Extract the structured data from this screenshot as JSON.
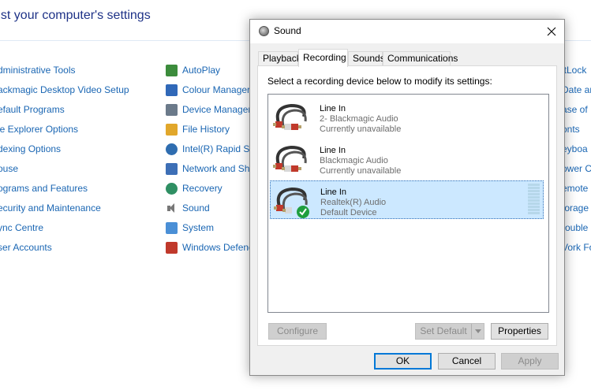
{
  "control_panel": {
    "title": "ust your computer's settings",
    "left_column": [
      "dministrative Tools",
      "ackmagic Desktop Video Setup",
      "efault Programs",
      "le Explorer Options",
      "dexing Options",
      "ouse",
      "ograms and Features",
      "ecurity and Maintenance",
      "ync Centre",
      "ser Accounts"
    ],
    "middle_column": [
      {
        "label": "AutoPlay",
        "icon": "autoplay-icon"
      },
      {
        "label": "Colour Manager",
        "icon": "colour-management-icon"
      },
      {
        "label": "Device Manager",
        "icon": "device-manager-icon"
      },
      {
        "label": "File History",
        "icon": "file-history-icon"
      },
      {
        "label": "Intel(R) Rapid Sto",
        "icon": "intel-rapid-storage-icon"
      },
      {
        "label": "Network and Sha",
        "icon": "network-icon"
      },
      {
        "label": "Recovery",
        "icon": "recovery-icon"
      },
      {
        "label": "Sound",
        "icon": "sound-icon"
      },
      {
        "label": "System",
        "icon": "system-icon"
      },
      {
        "label": "Windows Defend",
        "icon": "windows-defender-icon"
      }
    ],
    "right_column": [
      "itLock",
      "Date an",
      "ase of",
      "onts",
      "eyboa",
      "ower C",
      "emote",
      "torage",
      "rouble",
      "Vork Fo"
    ]
  },
  "dialog": {
    "title": "Sound",
    "tabs": [
      {
        "label": "Playback",
        "active": false
      },
      {
        "label": "Recording",
        "active": true
      },
      {
        "label": "Sounds",
        "active": false
      },
      {
        "label": "Communications",
        "active": false
      }
    ],
    "instruction": "Select a recording device below to modify its settings:",
    "devices": [
      {
        "name": "Line In",
        "driver": "2- Blackmagic Audio",
        "status": "Currently unavailable",
        "selected": false,
        "default": false
      },
      {
        "name": "Line In",
        "driver": "Blackmagic Audio",
        "status": "Currently unavailable",
        "selected": false,
        "default": false
      },
      {
        "name": "Line In",
        "driver": "Realtek(R) Audio",
        "status": "Default Device",
        "selected": true,
        "default": true
      }
    ],
    "buttons": {
      "configure": "Configure",
      "set_default": "Set Default",
      "properties": "Properties",
      "ok": "OK",
      "cancel": "Cancel",
      "apply": "Apply"
    }
  },
  "colors": {
    "link": "#1a66b3",
    "title": "#1e3287",
    "selection": "#cce8ff",
    "focus_border": "#0078d7"
  }
}
